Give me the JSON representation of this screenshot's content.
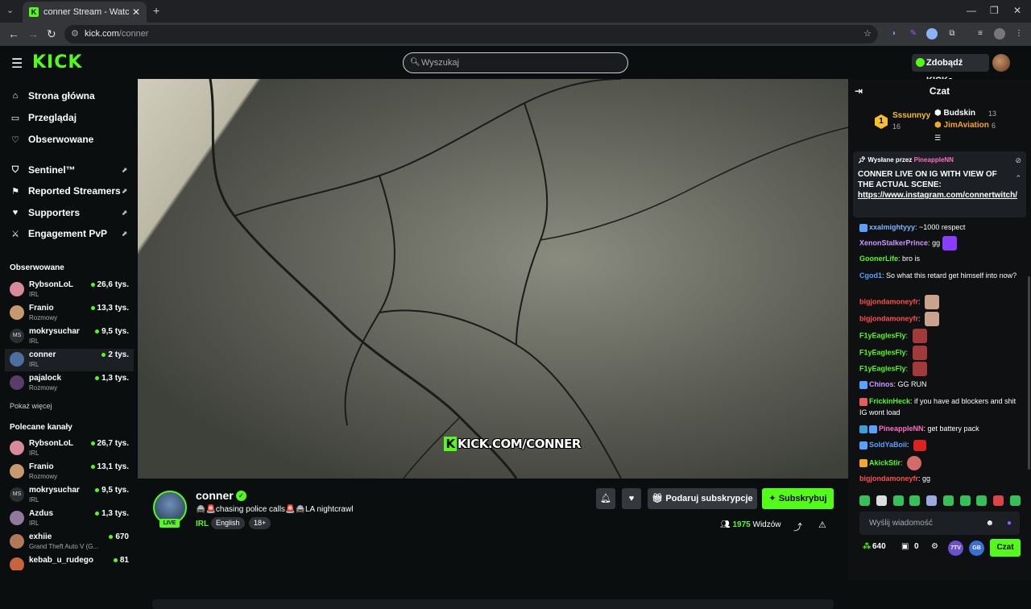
{
  "browser": {
    "tab_title": "conner Stream - Watch Live",
    "url_host": "kick.com",
    "url_path": "/conner"
  },
  "header": {
    "logo": "KICK",
    "search_placeholder": "Wyszukaj",
    "kicks_button": "Zdobądź KICKs"
  },
  "sidebar": {
    "nav": [
      {
        "label": "Strona główna",
        "icon": "home-icon"
      },
      {
        "label": "Przeglądaj",
        "icon": "browse-icon"
      },
      {
        "label": "Obserwowane",
        "icon": "heart-icon"
      }
    ],
    "extensions": [
      {
        "label": "Sentinel™",
        "icon": "shield-icon"
      },
      {
        "label": "Reported Streamers",
        "icon": "flag-icon"
      },
      {
        "label": "Supporters",
        "icon": "heart-icon"
      },
      {
        "label": "Engagement PvP",
        "icon": "swords-icon"
      }
    ],
    "followed_title": "Obserwowane",
    "followed": [
      {
        "name": "RybsonLoL",
        "category": "IRL",
        "viewers": "26,6 tys."
      },
      {
        "name": "Franio",
        "category": "Rozmowy",
        "viewers": "13,3 tys."
      },
      {
        "name": "mokrysuchar",
        "category": "IRL",
        "viewers": "9,5 tys."
      },
      {
        "name": "conner",
        "category": "IRL",
        "viewers": "2 tys."
      },
      {
        "name": "pajalock",
        "category": "Rozmowy",
        "viewers": "1,3 tys."
      }
    ],
    "show_more": "Pokaż więcej",
    "recommended_title": "Polecane kanały",
    "recommended": [
      {
        "name": "RybsonLoL",
        "category": "IRL",
        "viewers": "26,7 tys."
      },
      {
        "name": "Franio",
        "category": "Rozmowy",
        "viewers": "13,1 tys."
      },
      {
        "name": "mokrysuchar",
        "category": "IRL",
        "viewers": "9,5 tys."
      },
      {
        "name": "Azdus",
        "category": "IRL",
        "viewers": "1,3 tys."
      },
      {
        "name": "exhiie",
        "category": "Grand Theft Auto V (G...",
        "viewers": "670"
      },
      {
        "name": "kebab_u_rudego",
        "category": "",
        "viewers": "81"
      }
    ]
  },
  "player": {
    "watermark": "KICK.COM/CONNER"
  },
  "stream": {
    "streamer": "conner",
    "live_badge": "LIVE",
    "title": "🚔🚨chasing police calls🚨🚔LA nightcrawl",
    "category": "IRL",
    "tags": [
      "English",
      "18+"
    ],
    "gift_label": "Podaruj subskrypcje",
    "subscribe_label": "Subskrybuj",
    "viewer_count": "1975",
    "viewer_label": "Widzów"
  },
  "chat": {
    "title": "Czat",
    "leaderboard": [
      {
        "rank": "1",
        "name": "Sssunnyy",
        "count": "16"
      },
      {
        "name": "Budskin",
        "count": "13"
      },
      {
        "name": "JimAviation",
        "count": "6"
      }
    ],
    "pinned": {
      "prefix": "Wysłane przez",
      "user": "PineappleNN",
      "text": "CONNER LIVE ON IG WITH VIEW OF THE ACTUAL SCENE:",
      "link": "https://www.instagram.com/connertwitch/"
    },
    "messages": [
      {
        "user": "xxalmightyyy",
        "text": "~1000 respect",
        "color": "#7ab7ff"
      },
      {
        "user": "XenonStalkerPrince",
        "text": "gg",
        "color": "#c89bff"
      },
      {
        "user": "GoonerLife",
        "text": "bro is",
        "color": "#53fc18"
      },
      {
        "user": "Cgod1",
        "text": "So what this retard get himself into now?",
        "color": "#5aa0ff"
      },
      {
        "user": "bigjondamoneyfr",
        "text": "",
        "color": "#ff4d4d"
      },
      {
        "user": "bigjondamoneyfr",
        "text": "",
        "color": "#ff4d4d"
      },
      {
        "user": "F1yEaglesFly",
        "text": "",
        "color": "#53fc18"
      },
      {
        "user": "F1yEaglesFly",
        "text": "",
        "color": "#53fc18"
      },
      {
        "user": "F1yEaglesFly",
        "text": "",
        "color": "#53fc18"
      },
      {
        "user": "Chinos",
        "text": "GG RUN",
        "color": "#c89bff"
      },
      {
        "user": "FrickinHeck",
        "text": "if you have ad blockers and shit IG wont load",
        "color": "#53fc18"
      },
      {
        "user": "PineappleNN",
        "text": "get battery pack",
        "color": "#ff6ec4"
      },
      {
        "user": "SoldYaBoii",
        "text": "",
        "color": "#5aa0ff"
      },
      {
        "user": "AkickStir",
        "text": "",
        "color": "#53fc18"
      },
      {
        "user": "bigjondamoneyfr",
        "text": "gg",
        "color": "#ff4d4d"
      }
    ],
    "input_placeholder": "Wyślij wiadomość",
    "points": "640",
    "drops": "0",
    "send_label": "Czat"
  },
  "colors": {
    "brand": "#53fc18"
  }
}
